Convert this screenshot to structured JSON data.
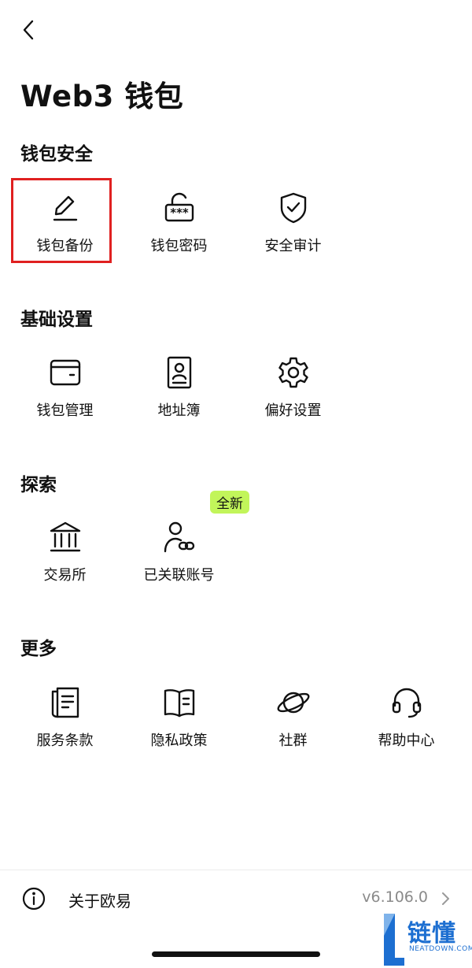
{
  "header": {
    "title": "Web3 钱包"
  },
  "sections": [
    {
      "title": "钱包安全",
      "items": [
        {
          "label": "钱包备份"
        },
        {
          "label": "钱包密码"
        },
        {
          "label": "安全审计"
        }
      ]
    },
    {
      "title": "基础设置",
      "items": [
        {
          "label": "钱包管理"
        },
        {
          "label": "地址簿"
        },
        {
          "label": "偏好设置"
        }
      ]
    },
    {
      "title": "探索",
      "items": [
        {
          "label": "交易所"
        },
        {
          "label": "已关联账号",
          "badge": "全新"
        }
      ]
    },
    {
      "title": "更多",
      "items": [
        {
          "label": "服务条款"
        },
        {
          "label": "隐私政策"
        },
        {
          "label": "社群"
        },
        {
          "label": "帮助中心"
        }
      ]
    }
  ],
  "footer": {
    "about_label": "关于欧易",
    "version": "v6.106.0"
  },
  "watermark": {
    "text": "链懂",
    "subtext": "NEATDOWN.COM"
  },
  "colors": {
    "highlight": "#e02020",
    "badge": "#c2f55a",
    "watermark": "#1d6fd1"
  }
}
